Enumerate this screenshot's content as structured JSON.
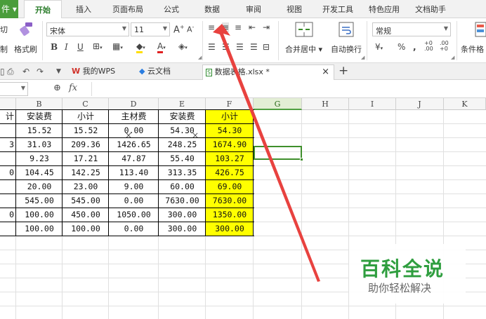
{
  "menu": {
    "app_label": "件",
    "tabs": [
      "开始",
      "插入",
      "页面布局",
      "公式",
      "数据",
      "审阅",
      "视图",
      "开发工具",
      "特色应用",
      "文档助手"
    ],
    "active_tab": "开始"
  },
  "ribbon": {
    "clipboard": {
      "cut": "切",
      "copy": "制",
      "format_painter": "格式刷"
    },
    "font": {
      "name": "宋体",
      "size": "11",
      "bold": "B",
      "italic": "I",
      "underline": "U"
    },
    "alignment": {
      "merge_center": "合并居中",
      "wrap_text": "自动换行"
    },
    "number": {
      "format": "常规",
      "percent": "%",
      "comma": ","
    },
    "styles": {
      "conditional_format": "条件格"
    }
  },
  "tab_bar": {
    "tabs": [
      {
        "label": "我的WPS"
      },
      {
        "label": "云文档"
      },
      {
        "label": "数据表格.xlsx *"
      }
    ],
    "new_tab": "+"
  },
  "formula_bar": {
    "fx_label": "fx",
    "value": ""
  },
  "sheet": {
    "columns": [
      "B",
      "C",
      "D",
      "E",
      "F",
      "G",
      "H",
      "I",
      "J",
      "K"
    ],
    "selected_column": "G",
    "col_a_partial": [
      "计",
      "",
      "3",
      "",
      "0",
      "",
      "",
      "0",
      ""
    ],
    "rows": [
      [
        "安装费",
        "小计",
        "主材费",
        "安装费",
        "小计"
      ],
      [
        "15.52",
        "15.52",
        "0.00",
        "54.30",
        "54.30"
      ],
      [
        "31.03",
        "209.36",
        "1426.65",
        "248.25",
        "1674.90"
      ],
      [
        "9.23",
        "17.21",
        "47.87",
        "55.40",
        "103.27"
      ],
      [
        "104.45",
        "142.25",
        "113.40",
        "313.35",
        "426.75"
      ],
      [
        "20.00",
        "23.00",
        "9.00",
        "60.00",
        "69.00"
      ],
      [
        "545.00",
        "545.00",
        "0.00",
        "7630.00",
        "7630.00"
      ],
      [
        "100.00",
        "450.00",
        "1050.00",
        "300.00",
        "1350.00"
      ],
      [
        "100.00",
        "100.00",
        "0.00",
        "300.00",
        "300.00"
      ]
    ],
    "highlight_color": "#ffff00"
  },
  "watermark": {
    "title": "百科全说",
    "subtitle": "助你轻松解决"
  },
  "colors": {
    "accent": "#4a9d3b",
    "arrow": "#e8423f"
  }
}
